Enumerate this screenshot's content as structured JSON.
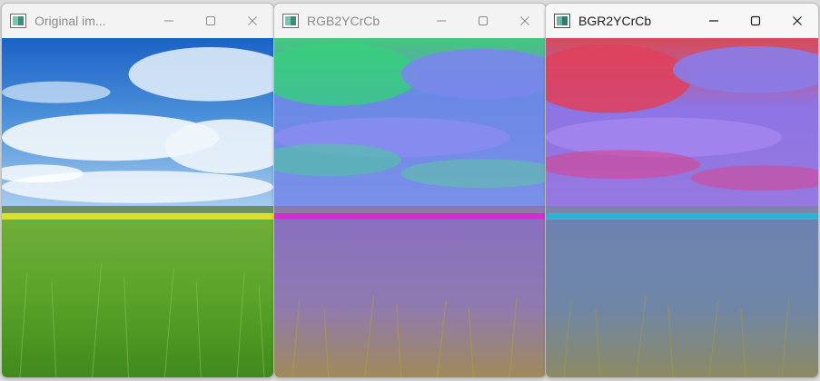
{
  "windows": [
    {
      "title": "Original im...",
      "image": "landscape-original",
      "active": false
    },
    {
      "title": "RGB2YCrCb",
      "image": "landscape-rgb2ycrcb",
      "active": false
    },
    {
      "title": "BGR2YCrCb",
      "image": "landscape-bgr2ycrcb",
      "active": true
    }
  ],
  "controls": {
    "minimize_icon": "minimize-icon",
    "maximize_icon": "maximize-icon",
    "close_icon": "close-icon"
  },
  "colors": {
    "original_sky_top": "#1f6fcf",
    "original_grass": "#5aa82a",
    "original_flower_strip": "#e4e02a",
    "rgb2ycrcb_sky": "#6f86ea",
    "rgb2ycrcb_sky_green": "#3fcf8a",
    "rgb2ycrcb_strip": "#d02bd0",
    "bgr2ycrcb_sky": "#8a78e8",
    "bgr2ycrcb_sky_red": "#e0405a",
    "bgr2ycrcb_strip": "#29b6d6"
  }
}
